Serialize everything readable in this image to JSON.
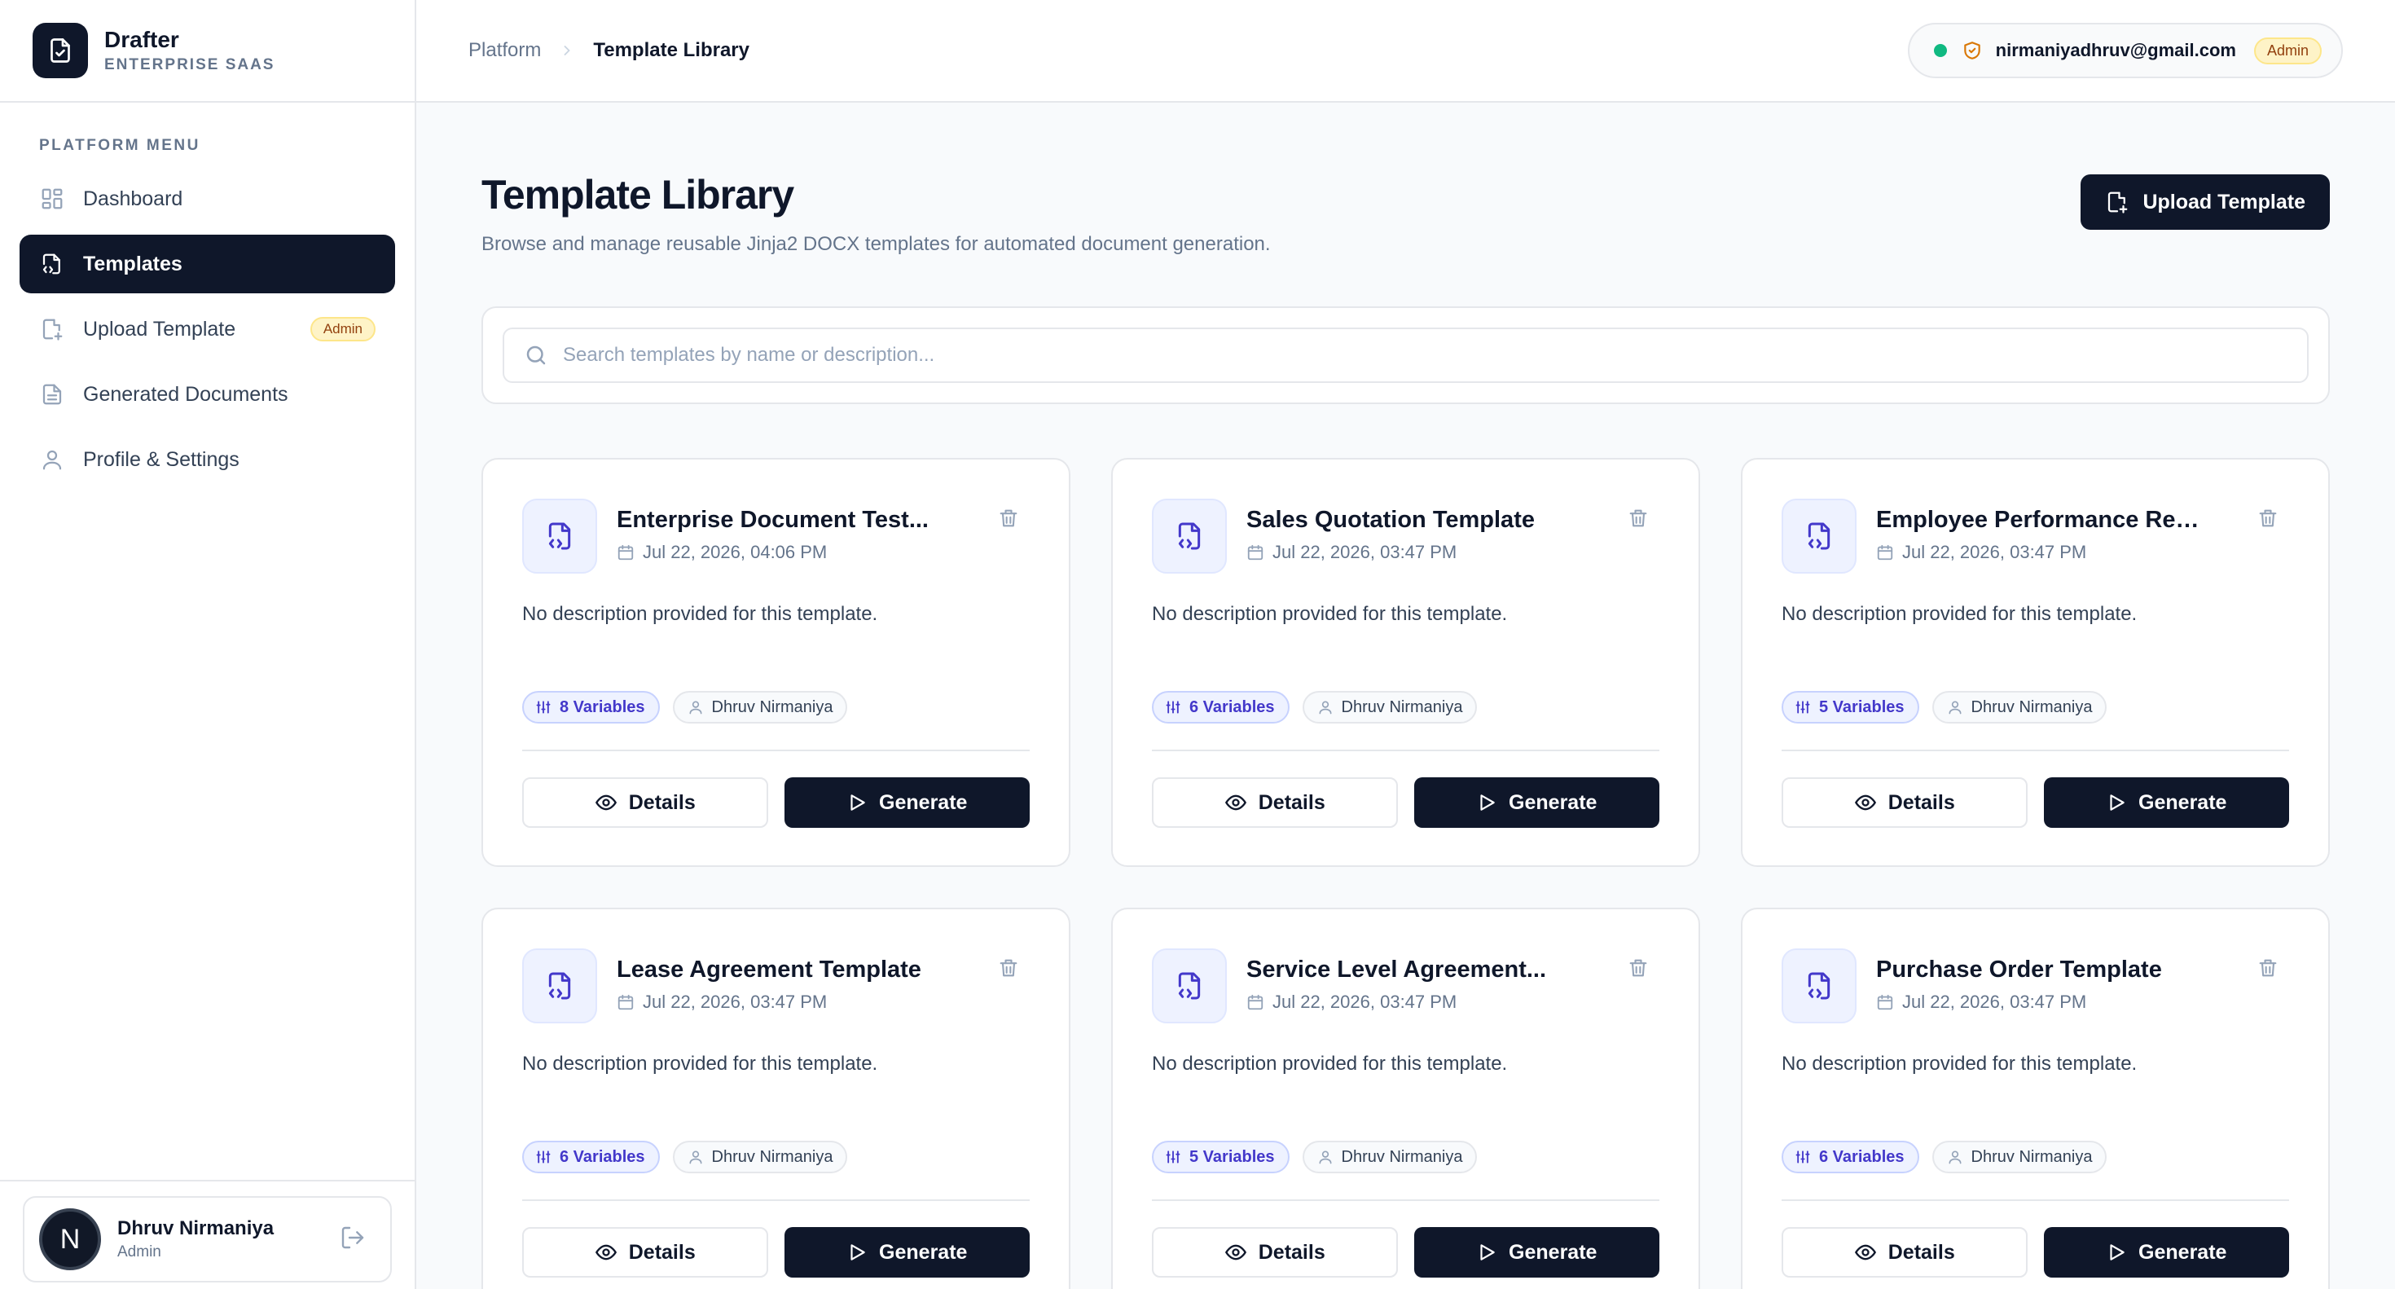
{
  "brand": {
    "name": "Drafter",
    "subtitle": "ENTERPRISE SAAS"
  },
  "sidebar": {
    "heading": "PLATFORM MENU",
    "items": [
      {
        "label": "Dashboard",
        "icon": "dashboard-icon"
      },
      {
        "label": "Templates",
        "icon": "file-code-icon",
        "active": true
      },
      {
        "label": "Upload Template",
        "icon": "file-upload-icon",
        "badge": "Admin"
      },
      {
        "label": "Generated Documents",
        "icon": "document-icon"
      },
      {
        "label": "Profile & Settings",
        "icon": "user-icon"
      }
    ],
    "user": {
      "initial": "N",
      "name": "Dhruv Nirmaniya",
      "role": "Admin"
    }
  },
  "topbar": {
    "breadcrumb": {
      "parent": "Platform",
      "current": "Template Library"
    },
    "account": {
      "email": "nirmaniyadhruv@gmail.com",
      "badge": "Admin"
    }
  },
  "page": {
    "title": "Template Library",
    "description": "Browse and manage reusable Jinja2 DOCX templates for automated document generation.",
    "upload_label": "Upload Template"
  },
  "search": {
    "placeholder": "Search templates by name or description...",
    "value": ""
  },
  "cards": [
    {
      "title": "Enterprise Document Test...",
      "date": "Jul 22, 2026, 04:06 PM",
      "description": "No description provided for this template.",
      "variables": "8 Variables",
      "owner": "Dhruv Nirmaniya",
      "details_label": "Details",
      "generate_label": "Generate"
    },
    {
      "title": "Sales Quotation Template",
      "date": "Jul 22, 2026, 03:47 PM",
      "description": "No description provided for this template.",
      "variables": "6 Variables",
      "owner": "Dhruv Nirmaniya",
      "details_label": "Details",
      "generate_label": "Generate"
    },
    {
      "title": "Employee Performance Revie...",
      "date": "Jul 22, 2026, 03:47 PM",
      "description": "No description provided for this template.",
      "variables": "5 Variables",
      "owner": "Dhruv Nirmaniya",
      "details_label": "Details",
      "generate_label": "Generate"
    },
    {
      "title": "Lease Agreement Template",
      "date": "Jul 22, 2026, 03:47 PM",
      "description": "No description provided for this template.",
      "variables": "6 Variables",
      "owner": "Dhruv Nirmaniya",
      "details_label": "Details",
      "generate_label": "Generate"
    },
    {
      "title": "Service Level Agreement...",
      "date": "Jul 22, 2026, 03:47 PM",
      "description": "No description provided for this template.",
      "variables": "5 Variables",
      "owner": "Dhruv Nirmaniya",
      "details_label": "Details",
      "generate_label": "Generate"
    },
    {
      "title": "Purchase Order Template",
      "date": "Jul 22, 2026, 03:47 PM",
      "description": "No description provided for this template.",
      "variables": "6 Variables",
      "owner": "Dhruv Nirmaniya",
      "details_label": "Details",
      "generate_label": "Generate"
    }
  ],
  "colors": {
    "primary": "#0f172a",
    "accent": "#4338ca",
    "online": "#10b981",
    "admin_badge_bg": "#fef3c7",
    "admin_badge_text": "#92400e"
  }
}
